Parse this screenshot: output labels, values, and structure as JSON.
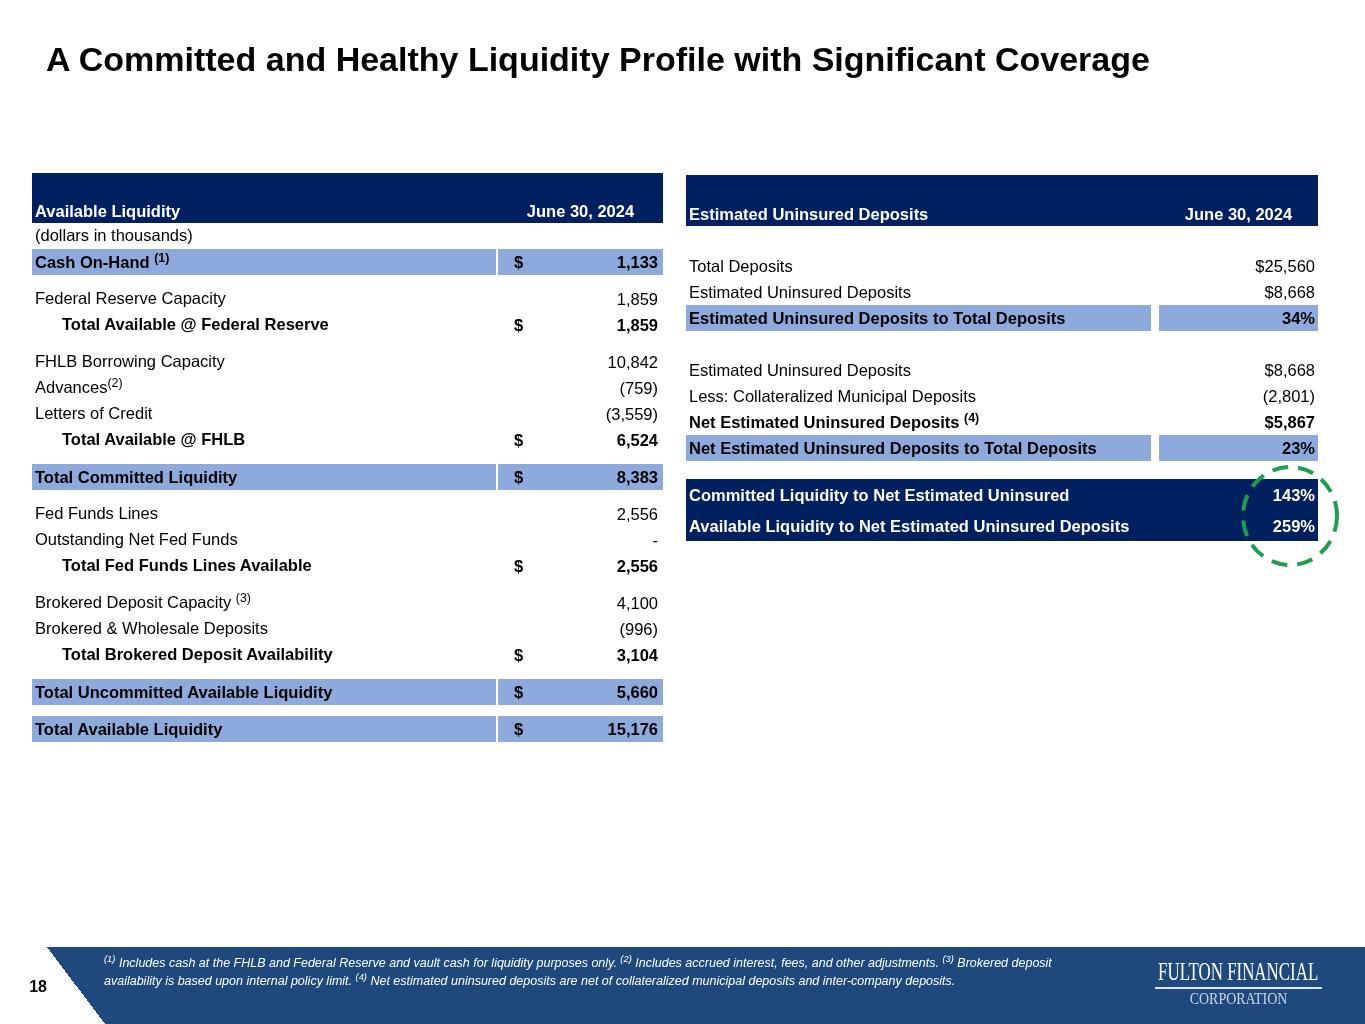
{
  "title": "A Committed and Healthy Liquidity Profile with Significant Coverage",
  "liquidity_table": {
    "columns": [
      "Available Liquidity",
      "June 30, 2024"
    ],
    "subtitle": "(dollars in thousands)",
    "groups": [
      [
        {
          "kind": "highlight",
          "label": "Cash On-Hand $^{(1)}$",
          "currency": "$",
          "value": "1,133"
        }
      ],
      [
        {
          "kind": "item",
          "label": "Federal Reserve Capacity",
          "value": "1,859"
        },
        {
          "kind": "subtotal",
          "label": "Total Available @ Federal Reserve",
          "currency": "$",
          "value": "1,859"
        }
      ],
      [
        {
          "kind": "item",
          "label": "FHLB Borrowing Capacity",
          "value": "10,842"
        },
        {
          "kind": "item",
          "label": "Advances$^{(2)}$",
          "value": "(759)"
        },
        {
          "kind": "item",
          "label": "Letters of Credit",
          "value": "(3,559)"
        },
        {
          "kind": "subtotal",
          "label": "Total Available @ FHLB",
          "currency": "$",
          "value": "6,524"
        }
      ],
      [
        {
          "kind": "highlight",
          "label": "Total Committed Liquidity",
          "currency": "$",
          "value": "8,383"
        }
      ],
      [
        {
          "kind": "item",
          "label": "Fed Funds Lines",
          "value": "2,556"
        },
        {
          "kind": "item",
          "label": "Outstanding Net Fed Funds",
          "value": "-"
        },
        {
          "kind": "subtotal",
          "label": "Total Fed Funds Lines Available",
          "currency": "$",
          "value": "2,556"
        }
      ],
      [
        {
          "kind": "item",
          "label": "Brokered Deposit Capacity $^{(3)}$",
          "value": "4,100"
        },
        {
          "kind": "item",
          "label": "Brokered & Wholesale Deposits",
          "value": "(996)"
        },
        {
          "kind": "subtotal",
          "label": "Total Brokered Deposit Availability",
          "currency": "$",
          "value": "3,104"
        }
      ],
      [
        {
          "kind": "highlight",
          "label": "Total Uncommitted Available Liquidity",
          "currency": "$",
          "value": "5,660"
        }
      ],
      [
        {
          "kind": "highlight",
          "label": "Total Available Liquidity",
          "currency": "$",
          "value": "15,176"
        }
      ]
    ]
  },
  "uninsured_table": {
    "columns": [
      "Estimated Uninsured Deposits",
      "June 30, 2024"
    ],
    "groups": [
      [
        {
          "kind": "item",
          "label": "Total Deposits",
          "value": "$25,560"
        },
        {
          "kind": "item",
          "label": "Estimated Uninsured Deposits",
          "value": "$8,668"
        },
        {
          "kind": "highlight",
          "label": "Estimated Uninsured Deposits to Total Deposits",
          "value": "34%"
        }
      ],
      [
        {
          "kind": "item",
          "label": "Estimated Uninsured Deposits",
          "value": "$8,668"
        },
        {
          "kind": "item",
          "label": "Less: Collateralized Municipal Deposits",
          "value": "(2,801)"
        },
        {
          "kind": "bold",
          "label": "Net Estimated Uninsured Deposits $^{(4)}$",
          "value": "$5,867"
        },
        {
          "kind": "highlight",
          "label": "Net Estimated Uninsured Deposits to Total Deposits",
          "value": "23%"
        }
      ]
    ],
    "summary": {
      "circled": true,
      "rows": [
        {
          "label": "Committed Liquidity to Net Estimated Uninsured",
          "value": "143%"
        },
        {
          "label": "Available Liquidity to Net Estimated Uninsured Deposits",
          "value": "259%"
        }
      ]
    }
  },
  "footer": {
    "page_number": "18",
    "footnote": "$^{(1)}$ Includes cash at the FHLB and Federal Reserve and vault cash for liquidity purposes only. $^{(2)}$ Includes accrued interest, fees, and other adjustments. $^{(3)}$ Brokered deposit availability is based upon internal policy limit. $^{(4)}$ Net estimated uninsured deposits are net of collateralized municipal deposits and inter-company deposits.",
    "logo": {
      "name": "FULTON FINANCIAL",
      "subtitle": "CORPORATION"
    }
  }
}
